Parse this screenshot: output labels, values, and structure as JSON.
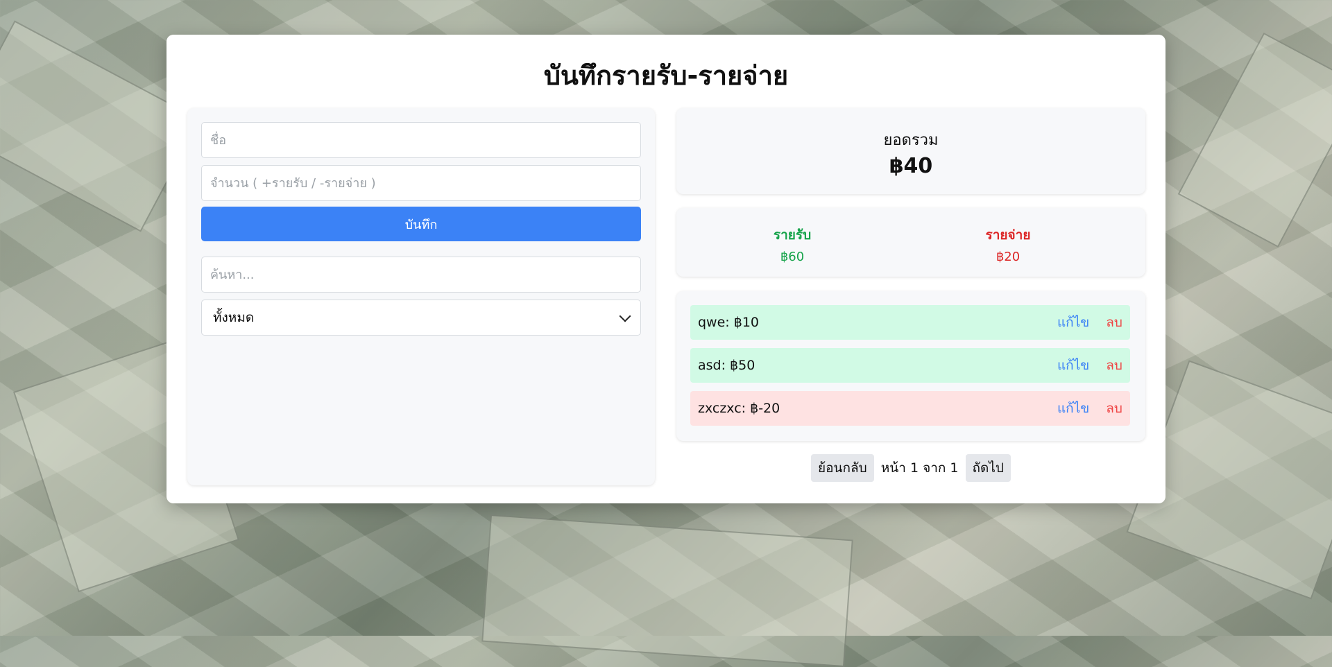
{
  "app": {
    "title": "บันทึกรายรับ-รายจ่าย"
  },
  "form": {
    "name_placeholder": "ชื่อ",
    "amount_placeholder": "จำนวน ( +รายรับ / -รายจ่าย )",
    "save_label": "บันทึก",
    "search_placeholder": "ค้นหา...",
    "filter_selected": "ทั้งหมด"
  },
  "summary": {
    "total_label": "ยอดรวม",
    "total_value": "฿40",
    "income_label": "รายรับ",
    "income_value": "฿60",
    "expense_label": "รายจ่าย",
    "expense_value": "฿20"
  },
  "transactions": [
    {
      "text": "qwe: ฿10",
      "type": "income",
      "edit": "แก้ไข",
      "delete": "ลบ"
    },
    {
      "text": "asd: ฿50",
      "type": "income",
      "edit": "แก้ไข",
      "delete": "ลบ"
    },
    {
      "text": "zxczxc: ฿-20",
      "type": "expense",
      "edit": "แก้ไข",
      "delete": "ลบ"
    }
  ],
  "pagination": {
    "prev_label": "ย้อนกลับ",
    "page_text": "หน้า 1 จาก 1",
    "next_label": "ถัดไป"
  },
  "colors": {
    "primary": "#3b82f6",
    "income": "#16a34a",
    "expense": "#dc2626",
    "income_bg": "#d1fae5",
    "expense_bg": "#fee2e2"
  }
}
